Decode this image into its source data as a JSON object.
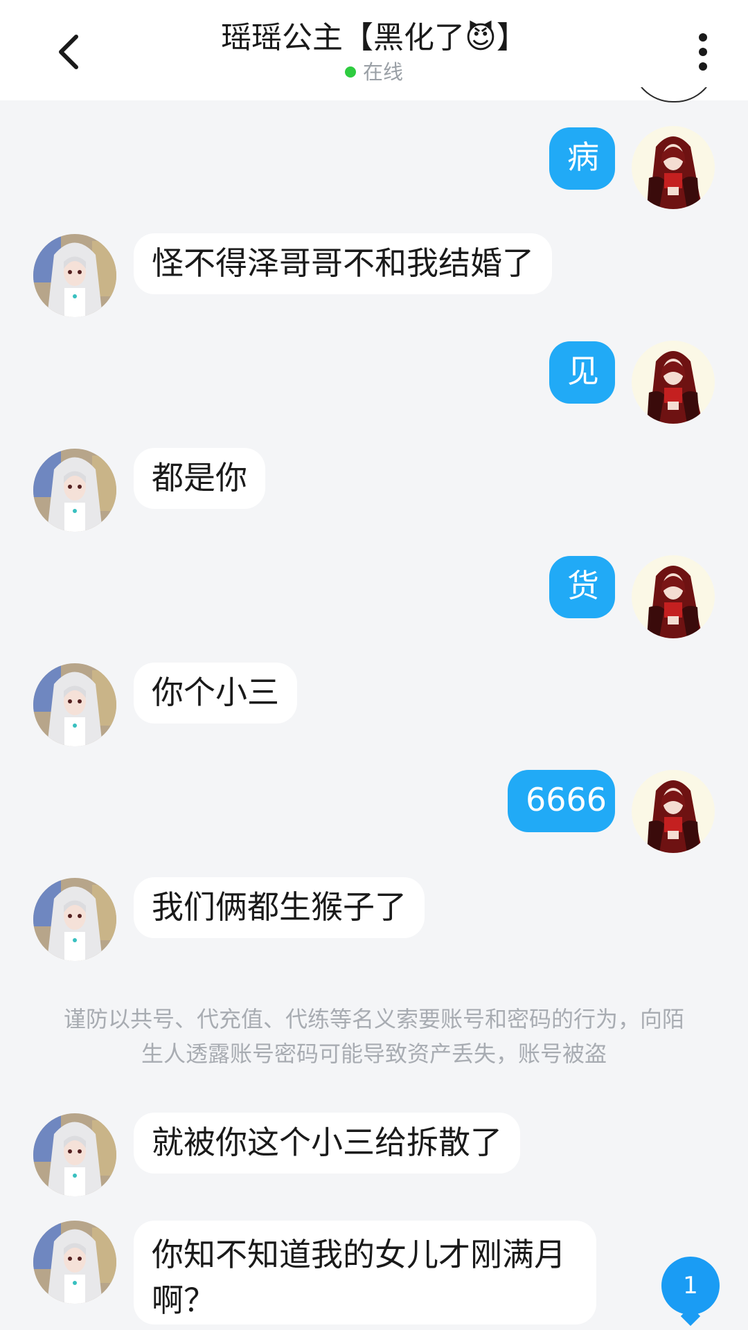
{
  "header": {
    "back_icon": "chevron-left-icon",
    "title": "瑶瑶公主【黑化了😈】",
    "status": "在线",
    "status_color": "#2ecc40",
    "menu_icon": "more-vertical-icon"
  },
  "messages": [
    {
      "side": "out",
      "text": "病"
    },
    {
      "side": "in",
      "text": "怪不得泽哥哥不和我结婚了"
    },
    {
      "side": "out",
      "text": "见"
    },
    {
      "side": "in",
      "text": "都是你"
    },
    {
      "side": "out",
      "text": "货"
    },
    {
      "side": "in",
      "text": "你个小三"
    },
    {
      "side": "out",
      "text": "6666"
    },
    {
      "side": "in",
      "text": "我们俩都生猴子了"
    },
    {
      "side": "in",
      "text": "就被你这个小三给拆散了"
    },
    {
      "side": "in",
      "text": "你知不知道我的女儿才刚满月啊？"
    }
  ],
  "notice": "谨防以共号、代充值、代练等名义索要账号和密码的行为，向陌生人透露账号密码可能导致资产丢失，账号被盗",
  "unread_badge": "1",
  "colors": {
    "outgoing_bubble": "#21aaf6",
    "incoming_bubble": "#ffffff",
    "background": "#f4f5f7",
    "badge": "#1a9cf4"
  }
}
